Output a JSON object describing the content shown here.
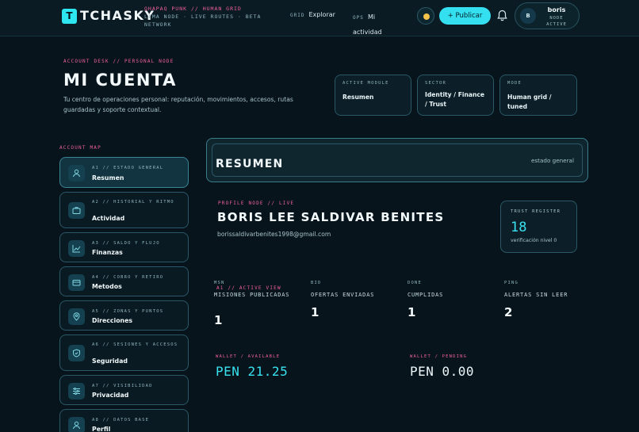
{
  "header": {
    "logo_letter": "T",
    "brand": "TCHASKY",
    "tagline_pink": "QHAPAQ PUNK // HUMAN GRID",
    "tagline_rest": "LIMA NODE · LIVE ROUTES · BETA NETWORK",
    "nav": [
      {
        "code": "GRID",
        "label": "Explorar"
      },
      {
        "code": "OPS",
        "label": "Mi actividad"
      }
    ],
    "publish_label": "+ Publicar",
    "user": {
      "initial": "B",
      "name": "boris",
      "status_line1": "NODE",
      "status_line2": "ACTIVE"
    }
  },
  "page": {
    "eyebrow": "ACCOUNT DESK // PERSONAL NODE",
    "title": "MI CUENTA",
    "description": "Tu centro de operaciones personal: reputación, movimientos, accesos, rutas guardadas y soporte contextual.",
    "info_cards": [
      {
        "label": "ACTIVE MODULE",
        "value": "Resumen"
      },
      {
        "label": "SECTOR",
        "value": "Identity / Finance / Trust"
      },
      {
        "label": "MODE",
        "value": "Human grid / tuned"
      }
    ]
  },
  "sidebar": {
    "title": "ACCOUNT MAP",
    "items": [
      {
        "code": "A1 // ESTADO GENERAL",
        "label": "Resumen",
        "icon": "user-icon"
      },
      {
        "code": "A2 // HISTORIAL Y RITMO",
        "label": "Actividad",
        "icon": "briefcase-icon"
      },
      {
        "code": "A3 // SALDO Y FLUJO",
        "label": "Finanzas",
        "icon": "chart-icon"
      },
      {
        "code": "A4 // COBRO Y RETIRO",
        "label": "Metodos",
        "icon": "card-icon"
      },
      {
        "code": "A5 // ZONAS Y PUNTOS",
        "label": "Direcciones",
        "icon": "location-icon"
      },
      {
        "code": "A6 // SESIONES Y ACCESOS",
        "label": "Seguridad",
        "icon": "shield-icon"
      },
      {
        "code": "A7 // VISIBILIDAD",
        "label": "Privacidad",
        "icon": "sliders-icon"
      },
      {
        "code": "A8 // DATOS BASE",
        "label": "Perfil",
        "icon": "user-icon"
      }
    ]
  },
  "main": {
    "active_view": {
      "eyebrow": "A1 // ACTIVE VIEW",
      "title": "RESUMEN",
      "right_text": "estado general"
    },
    "profile": {
      "eyebrow": "PROFILE NODE // LIVE",
      "name": "BORIS LEE SALDIVAR BENITES",
      "email": "borissaldivarbenites1998@gmail.com"
    },
    "trust": {
      "label": "TRUST REGISTER",
      "value": "18",
      "sub": "verificación nivel 0"
    },
    "stats": [
      {
        "code": "MSN",
        "label": "MISIONES PUBLICADAS",
        "value": "1"
      },
      {
        "code": "BID",
        "label": "OFERTAS ENVIADAS",
        "value": "1"
      },
      {
        "code": "DONE",
        "label": "CUMPLIDAS",
        "value": "1"
      },
      {
        "code": "PING",
        "label": "ALERTAS SIN LEER",
        "value": "2"
      }
    ],
    "wallet": {
      "available_label": "WALLET / AVAILABLE",
      "available_value": "PEN 21.25",
      "pending_label": "WALLET / PENDING",
      "pending_value": "PEN 0.00"
    }
  },
  "colors": {
    "accent": "#2ee6f0",
    "pink": "#f0609c",
    "background": "#07141c"
  }
}
